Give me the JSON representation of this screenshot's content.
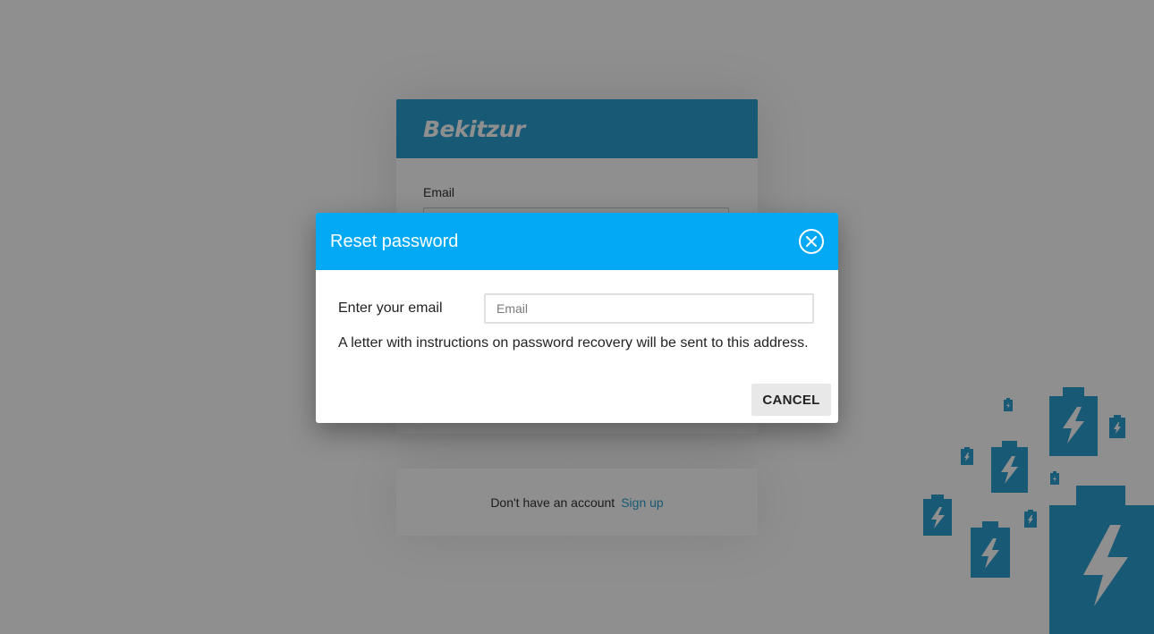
{
  "background": {
    "logo": "Bekitzur",
    "login": {
      "email_label": "Email"
    },
    "signup": {
      "prompt": "Don't have an account",
      "link": "Sign up"
    },
    "decoration_icon": "battery-bolt-icon"
  },
  "modal": {
    "title": "Reset password",
    "close_icon": "close-icon",
    "email_label": "Enter your email",
    "email_placeholder": "Email",
    "email_value": "",
    "info": "A letter with instructions on password recovery will be sent to this address.",
    "cancel_label": "CANCEL"
  },
  "colors": {
    "modal_header": "#03a9f4",
    "brand_blue": "#2b9fd1",
    "overlay": "rgba(0,0,0,0.44)"
  }
}
